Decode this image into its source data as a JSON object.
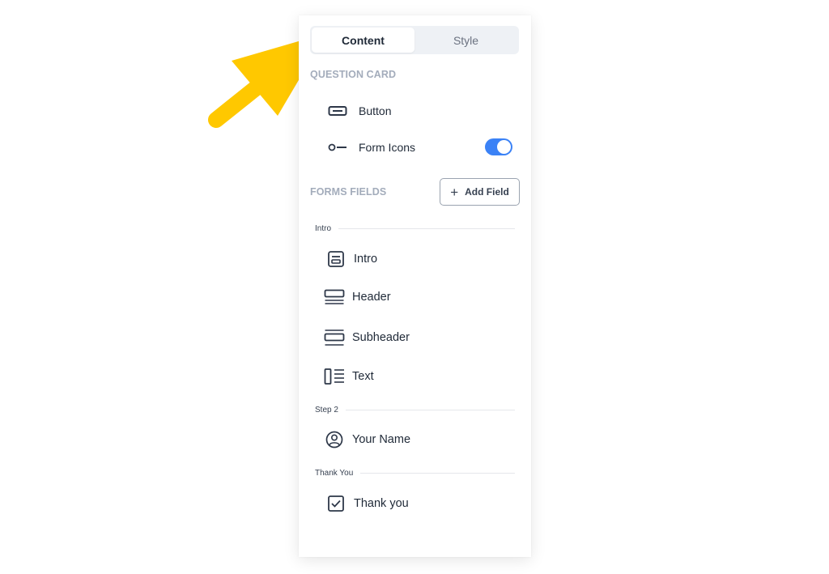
{
  "tabs": {
    "content": "Content",
    "style": "Style"
  },
  "question_card": {
    "title": "QUESTION CARD",
    "items": [
      {
        "label": "Button",
        "icon": "button-icon"
      },
      {
        "label": "Form Icons",
        "icon": "form-icons-icon",
        "toggle_on": true
      }
    ]
  },
  "forms_fields": {
    "title": "FORMS FIELDS",
    "add_button": "Add Field",
    "groups": [
      {
        "label": "Intro",
        "fields": [
          {
            "label": "Intro",
            "icon": "intro-icon"
          },
          {
            "label": "Header",
            "icon": "header-icon"
          },
          {
            "label": "Subheader",
            "icon": "subheader-icon"
          },
          {
            "label": "Text",
            "icon": "text-icon"
          }
        ]
      },
      {
        "label": "Step 2",
        "fields": [
          {
            "label": "Your Name",
            "icon": "user-circle-icon"
          }
        ]
      },
      {
        "label": "Thank You",
        "fields": [
          {
            "label": "Thank you",
            "icon": "checkbox-icon"
          }
        ]
      }
    ]
  },
  "colors": {
    "accent": "#3b82f6",
    "arrow": "#ffc800",
    "muted_heading": "#a3acbb"
  }
}
